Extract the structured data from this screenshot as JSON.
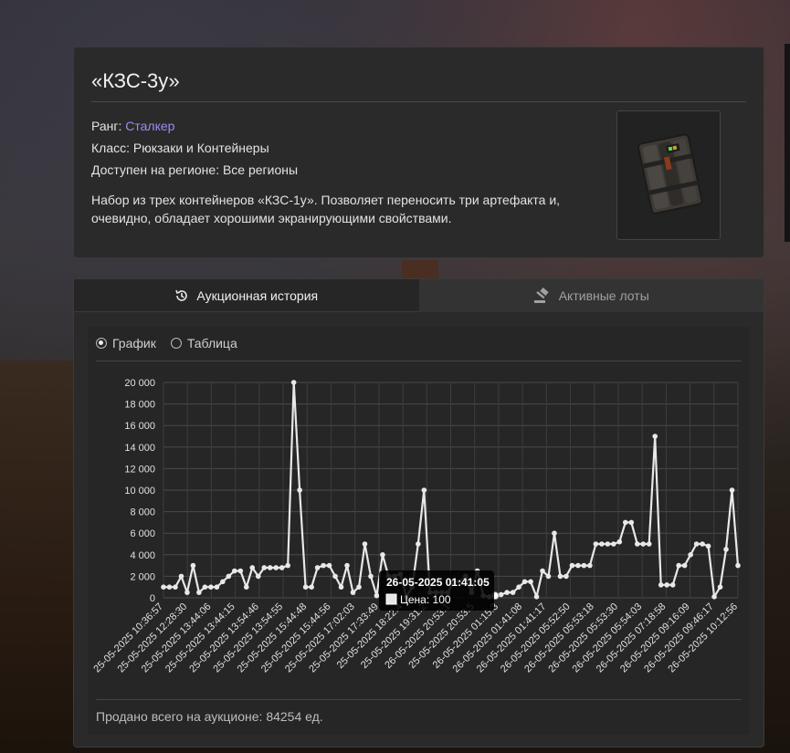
{
  "item": {
    "title": "«КЗС-3у»",
    "rank_label": "Ранг:",
    "rank_value": "Сталкер",
    "class_line": "Класс: Рюкзаки и Контейнеры",
    "region_line": "Доступен на регионе: Все регионы",
    "description": "Набор из трех контейнеров «КЗС-1у». Позволяет переносить три артефакта и, очевидно, обладает хорошими экранирующими свойствами.",
    "image_icon": "container-backpack-icon",
    "colors": {
      "rank": "#9b8cf0"
    }
  },
  "tabs": [
    {
      "label": "Аукционная история",
      "icon": "history-icon",
      "active": true
    },
    {
      "label": "Активные лоты",
      "icon": "gavel-icon",
      "active": false
    }
  ],
  "view": {
    "options": [
      {
        "label": "График",
        "selected": true
      },
      {
        "label": "Таблица",
        "selected": false
      }
    ]
  },
  "tooltip": {
    "title": "26-05-2025 01:41:05",
    "value_text": "Цена: 100"
  },
  "footer": {
    "total_text": "Продано всего на аукционе: 84254 ед."
  },
  "chart_data": {
    "type": "line",
    "ylim": [
      0,
      20000
    ],
    "y_ticks": [
      "0",
      "2 000",
      "4 000",
      "6 000",
      "8 000",
      "10 000",
      "12 000",
      "14 000",
      "16 000",
      "18 000",
      "20 000"
    ],
    "x_tick_labels": [
      "25-05-2025 10:36:57",
      "25-05-2025 12:28:30",
      "25-05-2025 13:44:06",
      "25-05-2025 13:44:15",
      "25-05-2025 13:54:46",
      "25-05-2025 13:54:55",
      "25-05-2025 15:44:48",
      "25-05-2025 15:44:56",
      "25-05-2025 17:02:03",
      "25-05-2025 17:33:49",
      "25-05-2025 18:22:4",
      "25-05-2025 19:31:2",
      "26-05-2025 20:53:1",
      "25-05-2025 20:53:5",
      "26-05-2025 01:15:3",
      "26-05-2025 01:41:08",
      "26-05-2025 01:41:17",
      "26-05-2025 05:52:50",
      "26-05-2025 05:53:18",
      "26-05-2025 05:53:30",
      "26-05-2025 05:54:03",
      "26-05-2025 07:18:58",
      "26-05-2025 09:16:09",
      "26-05-2025 09:46:17",
      "26-05-2025 10:12:56"
    ],
    "values": [
      1000,
      1000,
      1000,
      2000,
      500,
      3000,
      500,
      1000,
      1000,
      1000,
      1500,
      2000,
      2500,
      2500,
      1000,
      2800,
      2000,
      2800,
      2800,
      2800,
      2800,
      3000,
      20000,
      10000,
      1000,
      1000,
      2800,
      3000,
      3000,
      2000,
      1000,
      3000,
      500,
      1000,
      5000,
      2000,
      200,
      4000,
      2000,
      2000,
      2200,
      100,
      1000,
      5000,
      10000,
      500,
      500,
      500,
      500,
      1500,
      1500,
      2000,
      500,
      2500,
      200,
      100,
      200,
      300,
      500,
      500,
      1000,
      1500,
      1500,
      100,
      2500,
      2000,
      6000,
      2000,
      2000,
      3000,
      3000,
      3000,
      3000,
      5000,
      5000,
      5000,
      5000,
      5200,
      7000,
      7000,
      5000,
      5000,
      5000,
      15000,
      1200,
      1200,
      1200,
      3000,
      3000,
      4000,
      5000,
      5000,
      4800,
      100,
      1000,
      4500,
      10000,
      3000
    ],
    "highlight_index": 56,
    "line_color": "#e8e8e8"
  }
}
